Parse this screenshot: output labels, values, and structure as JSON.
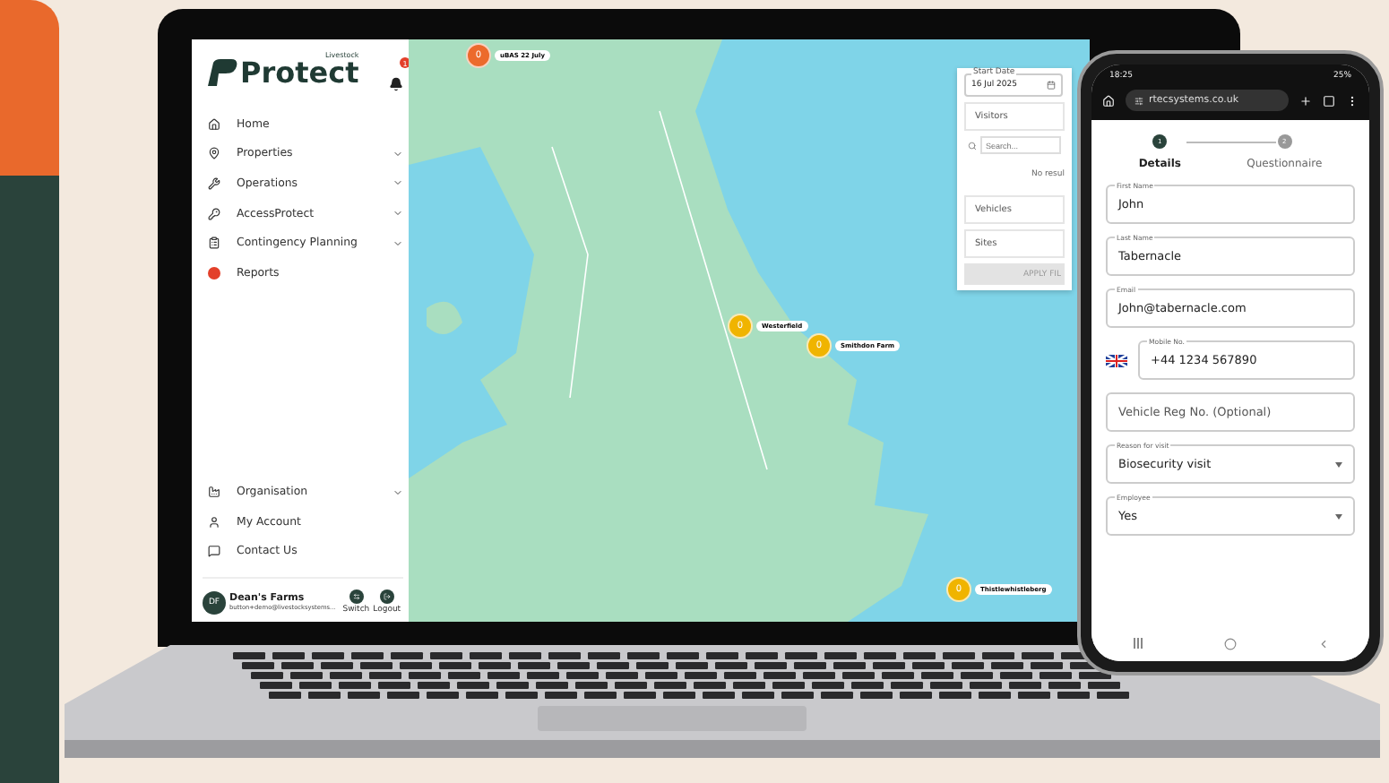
{
  "app": {
    "brand_small": "Livestock",
    "brand": "Protect",
    "notification_count": "1",
    "nav": [
      {
        "label": "Home",
        "kind": "link"
      },
      {
        "label": "Properties",
        "kind": "group"
      },
      {
        "label": "Operations",
        "kind": "group"
      },
      {
        "label": "AccessProtect",
        "kind": "group"
      },
      {
        "label": "Contingency Planning",
        "kind": "group"
      },
      {
        "label": "Reports",
        "kind": "link"
      }
    ],
    "nav_bottom": [
      {
        "label": "Organisation",
        "kind": "group"
      },
      {
        "label": "My Account",
        "kind": "link"
      },
      {
        "label": "Contact Us",
        "kind": "link"
      }
    ],
    "user": {
      "initials": "DF",
      "name": "Dean's Farms",
      "email": "button+demo@livestocksystems...",
      "actions": [
        "Switch",
        "Logout"
      ]
    }
  },
  "map": {
    "markers": [
      {
        "count": "0",
        "label": "uBAS 22 July",
        "color": "#ec6a2c"
      },
      {
        "count": "0",
        "label": "Westerfield",
        "color": "#f0b400"
      },
      {
        "count": "0",
        "label": "Smithdon Farm",
        "color": "#f0b400"
      },
      {
        "count": "0",
        "label": "Thistlewhistleberg",
        "color": "#f0b400"
      }
    ],
    "filter": {
      "date_label": "Start Date",
      "date_value": "16 Jul 2025",
      "sections": [
        "Visitors"
      ],
      "search_placeholder": "Search...",
      "empty_text": "No resul",
      "more_sections": [
        "Vehicles",
        "Sites"
      ],
      "apply": "APPLY FIL"
    }
  },
  "phone": {
    "time": "18:25",
    "battery": "25%",
    "url": "rtecsystems.co.uk",
    "steps": [
      {
        "number": "1",
        "label": "Details",
        "selected": true
      },
      {
        "number": "2",
        "label": "Questionnaire",
        "selected": false
      }
    ],
    "fields": [
      {
        "kind": "text",
        "label": "First Name",
        "value": "John"
      },
      {
        "kind": "text",
        "label": "Last Name",
        "value": "Tabernacle"
      },
      {
        "kind": "text",
        "label": "Email",
        "value": "John@tabernacle.com"
      },
      {
        "kind": "phone",
        "label": "Mobile No.",
        "value": "+44 1234 567890"
      },
      {
        "kind": "text",
        "placeholder": "Vehicle Reg No. (Optional)"
      },
      {
        "kind": "select",
        "label": "Reason for visit",
        "value": "Biosecurity visit"
      },
      {
        "kind": "select",
        "label": "Employee",
        "value": "Yes"
      }
    ]
  }
}
